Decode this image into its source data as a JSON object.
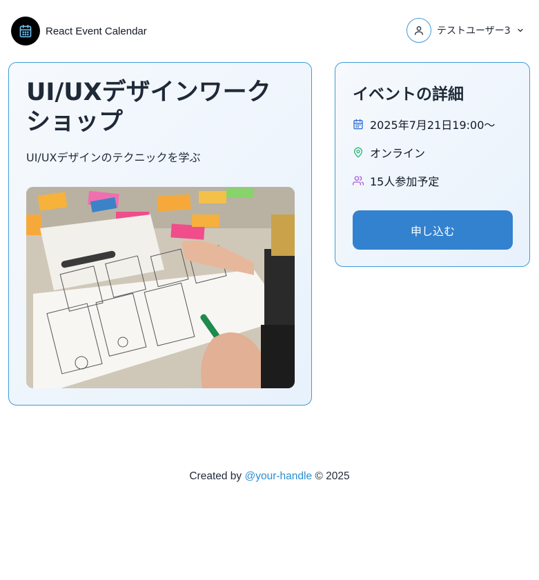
{
  "header": {
    "app_name": "React Event Calendar",
    "logo_icon": "calendar-icon",
    "user": {
      "name": "テストユーザー3",
      "avatar_icon": "user-icon",
      "dropdown_icon": "chevron-down-icon"
    }
  },
  "event": {
    "title": "UI/UXデザインワークショップ",
    "subtitle": "UI/UXデザインのテクニックを学ぶ",
    "image_icon": "workshop-photo"
  },
  "details": {
    "title": "イベントの詳細",
    "date": {
      "icon": "calendar-icon",
      "text": "2025年7月21日19:00〜"
    },
    "location": {
      "icon": "map-pin-icon",
      "text": "オンライン"
    },
    "attendees": {
      "icon": "users-icon",
      "text": "15人参加予定"
    },
    "apply_label": "申し込む"
  },
  "footer": {
    "prefix": "Created by ",
    "handle": "@your-handle",
    "suffix": " © 2025"
  },
  "colors": {
    "accent": "#3b9bd9",
    "button": "#3282cf",
    "link": "#2b8fd1",
    "date_icon": "#2f6fd1",
    "location_icon": "#2bb673",
    "attendees_icon": "#a55ad6"
  }
}
